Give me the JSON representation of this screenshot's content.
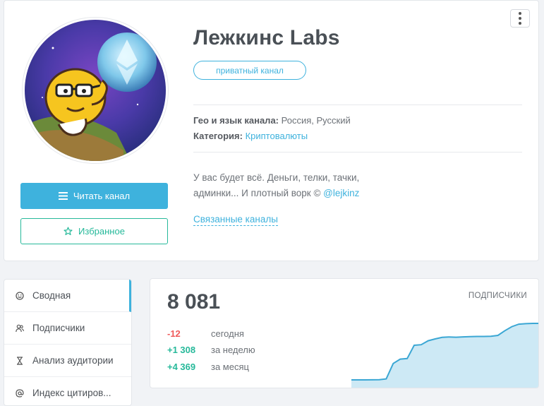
{
  "channel": {
    "title": "Лежкинс Labs",
    "badge": "приватный канал",
    "geo_label": "Гео и язык канала:",
    "geo_value": "Россия, Русский",
    "category_label": "Категория:",
    "category_value": "Криптовалюты",
    "description": "У вас будет всё. Деньги, телки, тачки, админки... И плотный ворк ©",
    "description_link": "@lejkinz",
    "related_link": "Связанные каналы",
    "read_button": "Читать канал",
    "favorite_button": "Избранное"
  },
  "nav": {
    "items": [
      {
        "label": "Сводная",
        "icon": "smile-icon",
        "active": true
      },
      {
        "label": "Подписчики",
        "icon": "users-icon",
        "active": false
      },
      {
        "label": "Анализ аудитории",
        "icon": "hourglass-icon",
        "active": false
      },
      {
        "label": "Индекс цитиров...",
        "icon": "at-icon",
        "active": false
      }
    ]
  },
  "stats": {
    "subscribers": "8 081",
    "label": "ПОДПИСЧИКИ",
    "rows": [
      {
        "value": "-12",
        "label": "сегодня",
        "sign": "neg"
      },
      {
        "value": "+1 308",
        "label": "за неделю",
        "sign": "pos"
      },
      {
        "value": "+4 369",
        "label": "за месяц",
        "sign": "pos"
      }
    ],
    "trend": [
      3712,
      3712,
      3713,
      3720,
      3725,
      3790,
      4980,
      5320,
      5360,
      6390,
      6430,
      6740,
      6880,
      7000,
      7030,
      7010,
      7040,
      7060,
      7070,
      7072,
      7080,
      7150,
      7520,
      7830,
      8020,
      8060,
      8081,
      8081
    ],
    "colors": {
      "line": "#3ba7d4",
      "fill": "#cde9f5",
      "accent": "#3eb2dd"
    }
  }
}
